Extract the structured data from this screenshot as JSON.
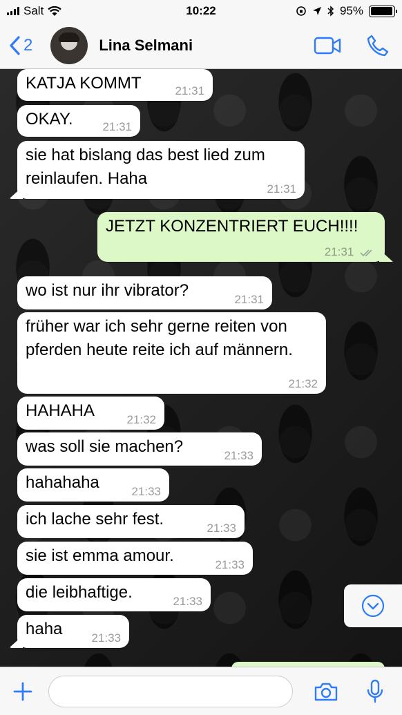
{
  "status_bar": {
    "carrier": "Salt",
    "time": "10:22",
    "battery": "95%",
    "battery_level": 0.95
  },
  "header": {
    "back_count": "2",
    "contact_name": "Lina Selmani"
  },
  "messages": [
    {
      "text": "KATJA KOMMT",
      "time": "21:31",
      "dir": "in"
    },
    {
      "text": "OKAY.",
      "time": "21:31",
      "dir": "in"
    },
    {
      "text": "sie hat bislang das best lied zum reinlaufen. Haha",
      "time": "21:31",
      "dir": "in"
    },
    {
      "text": "JETZT KONZENTRIERT EUCH!!!!",
      "time": "21:31",
      "dir": "out",
      "status": "read"
    },
    {
      "text": "wo ist nur ihr vibrator?",
      "time": "21:31",
      "dir": "in"
    },
    {
      "text": "früher war ich sehr gerne reiten von pferden heute reite ich auf männern.",
      "time": "21:32",
      "dir": "in"
    },
    {
      "text": "HAHAHA",
      "time": "21:32",
      "dir": "in"
    },
    {
      "text": "was soll sie machen?",
      "time": "21:33",
      "dir": "in"
    },
    {
      "text": "hahahaha",
      "time": "21:33",
      "dir": "in"
    },
    {
      "text": "ich lache sehr fest.",
      "time": "21:33",
      "dir": "in"
    },
    {
      "text": "sie ist emma amour.",
      "time": "21:33",
      "dir": "in"
    },
    {
      "text": "die leibhaftige.",
      "time": "21:33",
      "dir": "in"
    },
    {
      "text": "haha",
      "time": "21:33",
      "dir": "in"
    }
  ],
  "input": {
    "value": "",
    "placeholder": ""
  },
  "icons": {
    "back": "chevron-left-icon",
    "video": "video-camera-icon",
    "call": "phone-icon",
    "add": "plus-icon",
    "camera": "camera-icon",
    "mic": "microphone-icon",
    "scroll": "chevron-down-circle-icon"
  },
  "colors": {
    "accent": "#2f7cf6",
    "incoming_bubble": "#ffffff",
    "outgoing_bubble": "#dcf8c6"
  }
}
